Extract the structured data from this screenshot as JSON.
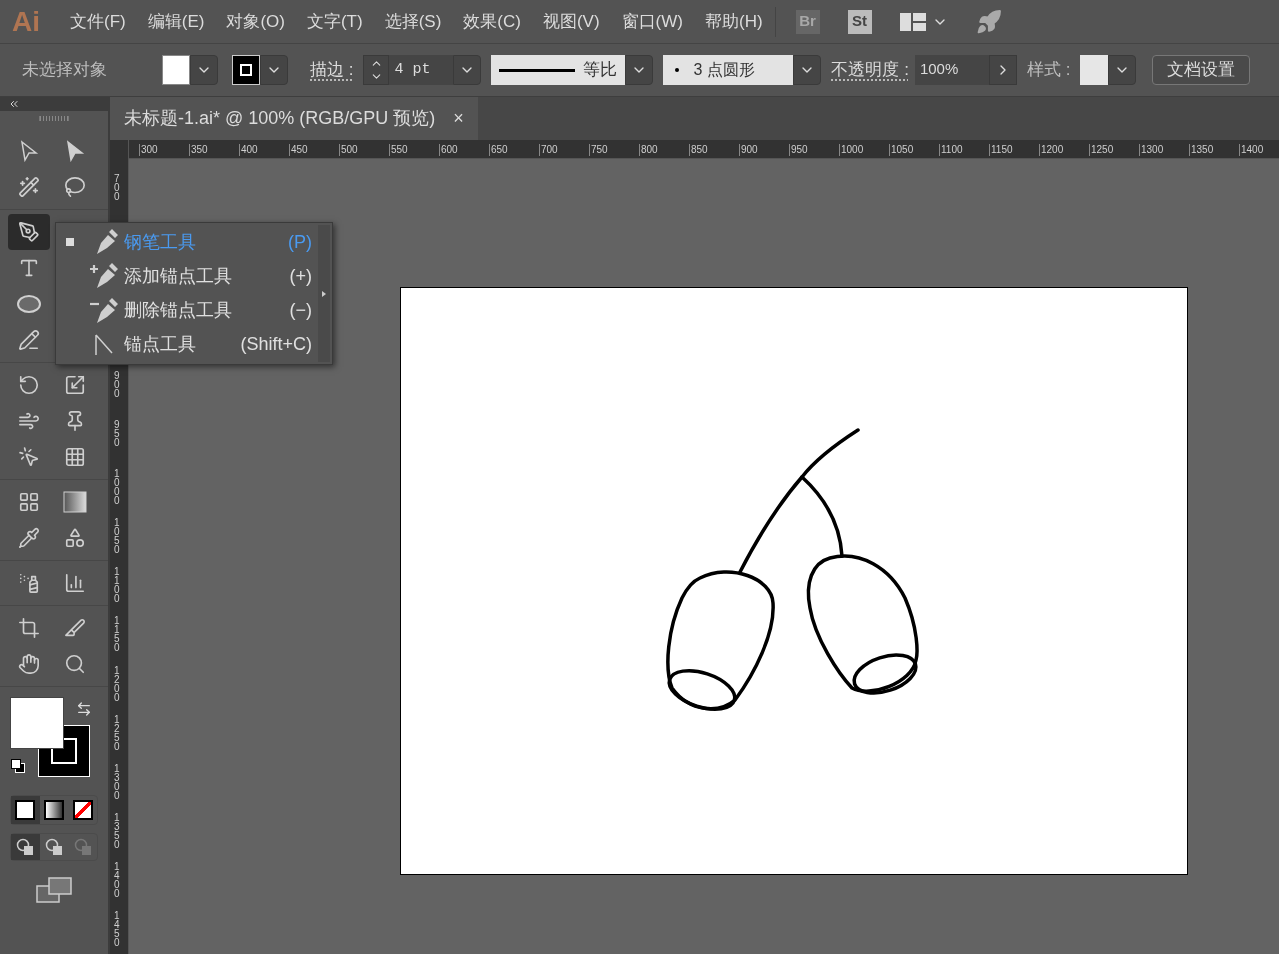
{
  "app_logo": "Ai",
  "menu": [
    "文件(F)",
    "编辑(E)",
    "对象(O)",
    "文字(T)",
    "选择(S)",
    "效果(C)",
    "视图(V)",
    "窗口(W)",
    "帮助(H)"
  ],
  "app_buttons": [
    {
      "label": "Br",
      "disabled": true
    },
    {
      "label": "St",
      "disabled": false
    }
  ],
  "control_bar": {
    "selection_label": "未选择对象",
    "stroke_label": "描边 :",
    "stroke_weight": "4 pt",
    "profile": "等比",
    "brush": "3 点圆形",
    "opacity_label": "不透明度 :",
    "opacity": "100%",
    "style_label": "样式 :",
    "doc_setup": "文档设置"
  },
  "document_tab": {
    "title": "未标题-1.ai* @ 100% (RGB/GPU 预览)",
    "close": "×"
  },
  "ruler_h": [
    "300",
    "350",
    "400",
    "450",
    "500",
    "550",
    "600",
    "650",
    "700",
    "750",
    "800",
    "850",
    "900",
    "950",
    "1000",
    "1050",
    "1100",
    "1150",
    "1200",
    "1250",
    "1300",
    "1350",
    "1400"
  ],
  "ruler_v": [
    "700",
    "900",
    "950",
    "1000",
    "1050",
    "1100",
    "1150",
    "1200",
    "1250",
    "1300",
    "1350",
    "1400",
    "1450"
  ],
  "tool_rows": [
    {
      "tools": [
        {
          "kind": "direct",
          "selected": false
        },
        {
          "kind": "select",
          "selected": false
        }
      ]
    },
    {
      "tools": [
        {
          "kind": "wand",
          "selected": false
        },
        {
          "kind": "lasso",
          "selected": false
        }
      ],
      "divider": true
    },
    {
      "tools": [
        {
          "kind": "pen",
          "selected": true
        }
      ]
    },
    {
      "tools": [
        {
          "kind": "type",
          "selected": false
        }
      ]
    },
    {
      "tools": [
        {
          "kind": "ellipse",
          "selected": false
        }
      ]
    },
    {
      "tools": [
        {
          "kind": "shaper",
          "selected": false
        }
      ],
      "divider": true
    },
    {
      "tools": [
        {
          "kind": "rotate",
          "selected": false
        },
        {
          "kind": "scale",
          "selected": false
        }
      ]
    },
    {
      "tools": [
        {
          "kind": "warp",
          "selected": false
        },
        {
          "kind": "pin",
          "selected": false
        }
      ]
    },
    {
      "tools": [
        {
          "kind": "builder",
          "selected": false
        },
        {
          "kind": "perspective",
          "selected": false
        }
      ],
      "divider": true
    },
    {
      "tools": [
        {
          "kind": "mesh",
          "selected": false
        },
        {
          "kind": "gradient",
          "selected": false
        }
      ]
    },
    {
      "tools": [
        {
          "kind": "eyedropper",
          "selected": false
        },
        {
          "kind": "blend",
          "selected": false
        }
      ],
      "divider": true
    },
    {
      "tools": [
        {
          "kind": "spray",
          "selected": false
        },
        {
          "kind": "graph",
          "selected": false
        }
      ],
      "divider": true
    },
    {
      "tools": [
        {
          "kind": "artboard",
          "selected": false
        },
        {
          "kind": "slice",
          "selected": false
        }
      ]
    },
    {
      "tools": [
        {
          "kind": "hand",
          "selected": false
        },
        {
          "kind": "zoom",
          "selected": false
        }
      ],
      "divider": true
    }
  ],
  "color_modes": [
    {
      "kind": "color",
      "selected": true
    },
    {
      "kind": "gradient",
      "selected": false
    },
    {
      "kind": "none",
      "selected": false
    }
  ],
  "draw_modes": [
    {
      "kind": "normal",
      "selected": true
    },
    {
      "kind": "behind",
      "selected": false
    },
    {
      "kind": "inside",
      "selected": false
    }
  ],
  "flyout": [
    {
      "kind": "pen",
      "label": "钢笔工具",
      "shortcut": "(P)",
      "selected": true
    },
    {
      "kind": "add",
      "label": "添加锚点工具",
      "shortcut": "(+)",
      "selected": false
    },
    {
      "kind": "delete",
      "label": "删除锚点工具",
      "shortcut": "(−)",
      "selected": false
    },
    {
      "kind": "anchor",
      "label": "锚点工具",
      "shortcut": "(Shift+C)",
      "selected": false
    }
  ]
}
